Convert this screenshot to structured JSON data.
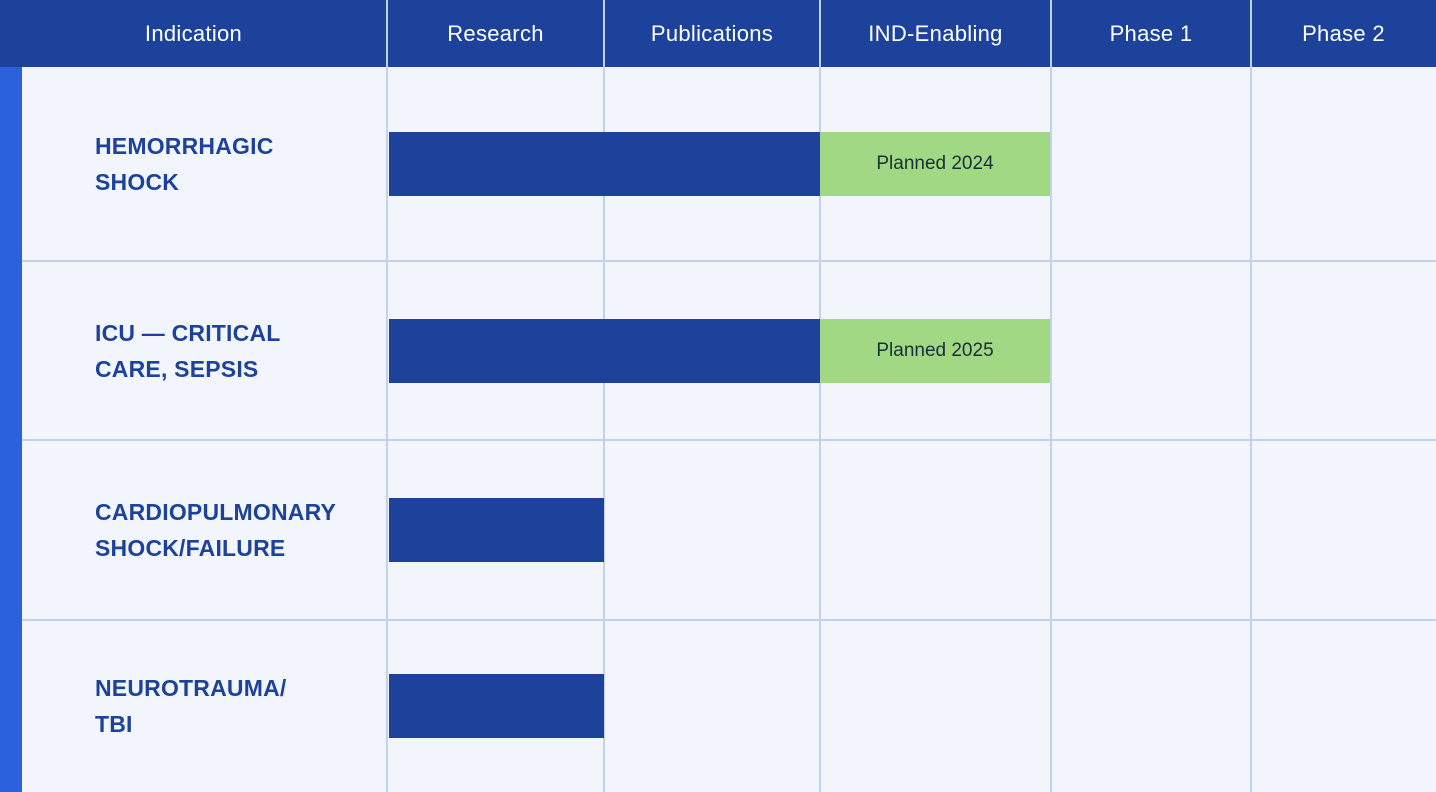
{
  "chart_data": {
    "type": "table",
    "columns": [
      "Indication",
      "Research",
      "Publications",
      "IND-Enabling",
      "Phase 1",
      "Phase 2"
    ],
    "stages": [
      "Research",
      "Publications",
      "IND-Enabling",
      "Phase 1",
      "Phase 2"
    ],
    "rows": [
      {
        "label": "HEMORRHAGIC\nSHOCK",
        "progress_stages": 2,
        "planned": {
          "stage": "IND-Enabling",
          "label": "Planned 2024"
        }
      },
      {
        "label": "ICU — CRITICAL\nCARE, SEPSIS",
        "progress_stages": 2,
        "planned": {
          "stage": "IND-Enabling",
          "label": "Planned 2025"
        }
      },
      {
        "label": "CARDIOPULMONARY\nSHOCK/FAILURE",
        "progress_stages": 1,
        "planned": null
      },
      {
        "label": "NEUROTRAUMA/\nTBI",
        "progress_stages": 1,
        "planned": null
      }
    ]
  },
  "colors": {
    "header": "#1d429b",
    "left_stripe": "#2b62dc",
    "background": "#f2f5fc",
    "grid": "#c3d2ec",
    "progress_bar": "#1d429b",
    "planned_bar": "#a1d883",
    "row_label": "#1d429b"
  }
}
